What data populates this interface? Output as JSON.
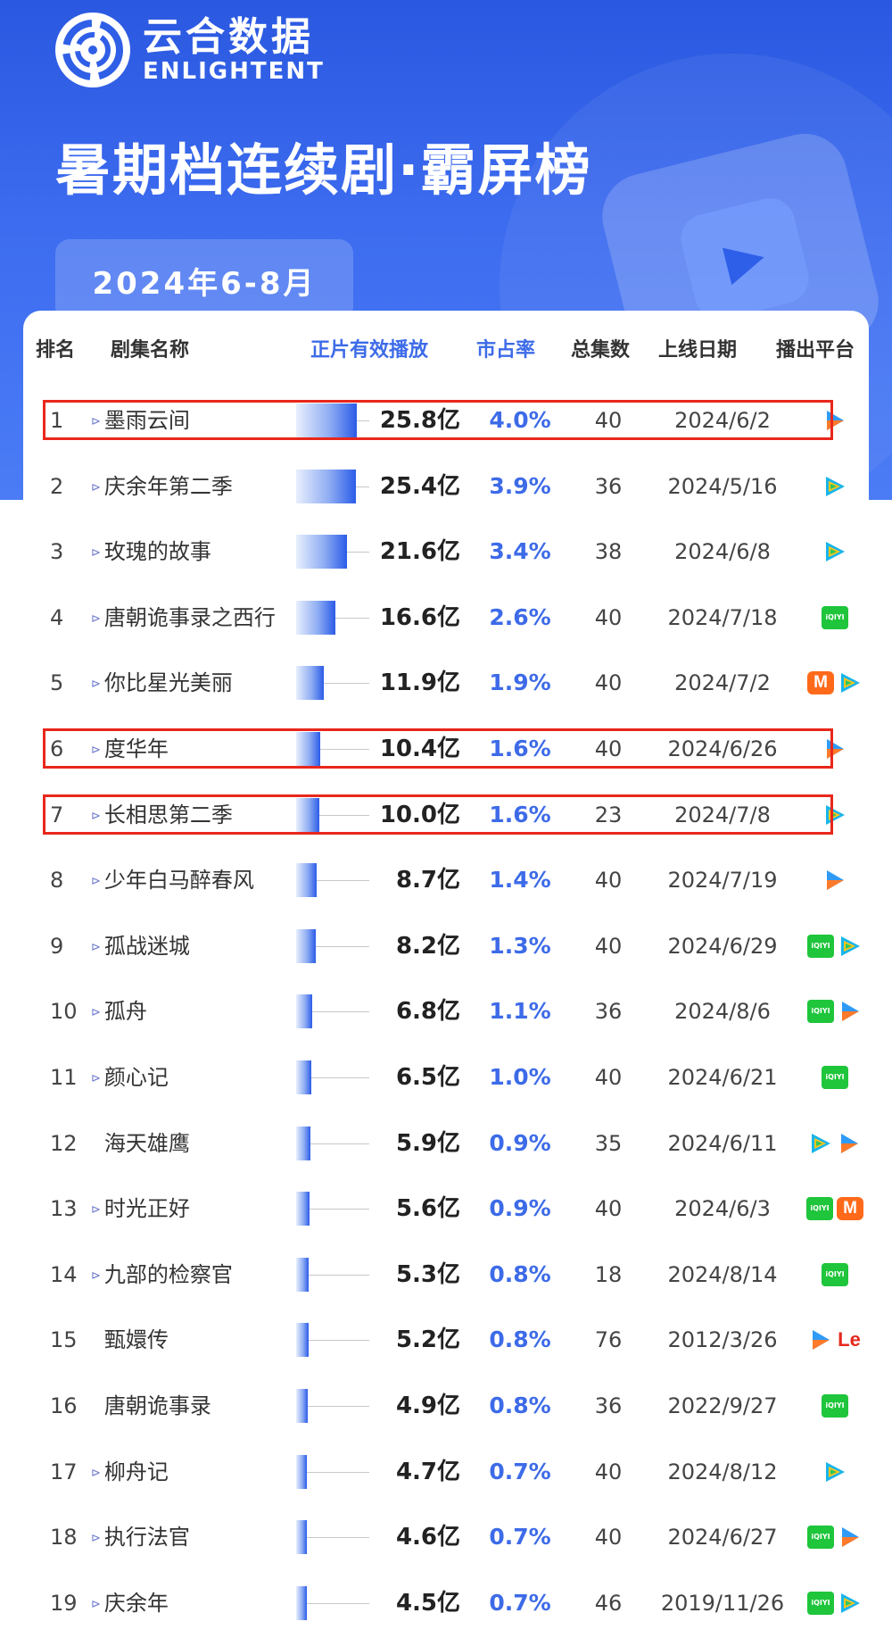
{
  "brand": {
    "name_cn": "云合数据",
    "name_en": "ENLIGHTENT"
  },
  "title": "暑期档连续剧·霸屏榜",
  "period": "2024年6-8月",
  "columns": {
    "rank": "排名",
    "name": "剧集名称",
    "plays": "正片有效播放",
    "share": "市占率",
    "episodes": "总集数",
    "date": "上线日期",
    "platform": "播出平台"
  },
  "colors": {
    "accent_blue": "#3d6be8",
    "highlight_red": "#e8271b",
    "iqiyi_green": "#1fc53b",
    "mango_orange": "#ff6a1a",
    "tencent_play": "#19b5ea",
    "youku_blue": "#2f9bf6"
  },
  "highlighted_ranks": [
    "1",
    "6",
    "7"
  ],
  "rows": [
    {
      "rank": "1",
      "name": "墨雨云间",
      "marker": true,
      "plays_value": 25.8,
      "plays": "25.8亿",
      "share": "4.0%",
      "episodes": "40",
      "date": "2024/6/2",
      "platforms": [
        "youku"
      ]
    },
    {
      "rank": "2",
      "name": "庆余年第二季",
      "marker": true,
      "plays_value": 25.4,
      "plays": "25.4亿",
      "share": "3.9%",
      "episodes": "36",
      "date": "2024/5/16",
      "platforms": [
        "tencent"
      ]
    },
    {
      "rank": "3",
      "name": "玫瑰的故事",
      "marker": true,
      "plays_value": 21.6,
      "plays": "21.6亿",
      "share": "3.4%",
      "episodes": "38",
      "date": "2024/6/8",
      "platforms": [
        "tencent"
      ]
    },
    {
      "rank": "4",
      "name": "唐朝诡事录之西行",
      "marker": true,
      "plays_value": 16.6,
      "plays": "16.6亿",
      "share": "2.6%",
      "episodes": "40",
      "date": "2024/7/18",
      "platforms": [
        "iqiyi"
      ]
    },
    {
      "rank": "5",
      "name": "你比星光美丽",
      "marker": true,
      "plays_value": 11.9,
      "plays": "11.9亿",
      "share": "1.9%",
      "episodes": "40",
      "date": "2024/7/2",
      "platforms": [
        "mango",
        "tencent"
      ]
    },
    {
      "rank": "6",
      "name": "度华年",
      "marker": true,
      "plays_value": 10.4,
      "plays": "10.4亿",
      "share": "1.6%",
      "episodes": "40",
      "date": "2024/6/26",
      "platforms": [
        "youku"
      ]
    },
    {
      "rank": "7",
      "name": "长相思第二季",
      "marker": true,
      "plays_value": 10.0,
      "plays": "10.0亿",
      "share": "1.6%",
      "episodes": "23",
      "date": "2024/7/8",
      "platforms": [
        "tencent"
      ]
    },
    {
      "rank": "8",
      "name": "少年白马醉春风",
      "marker": true,
      "plays_value": 8.7,
      "plays": "8.7亿",
      "share": "1.4%",
      "episodes": "40",
      "date": "2024/7/19",
      "platforms": [
        "youku"
      ]
    },
    {
      "rank": "9",
      "name": "孤战迷城",
      "marker": true,
      "plays_value": 8.2,
      "plays": "8.2亿",
      "share": "1.3%",
      "episodes": "40",
      "date": "2024/6/29",
      "platforms": [
        "iqiyi",
        "tencent"
      ]
    },
    {
      "rank": "10",
      "name": "孤舟",
      "marker": true,
      "plays_value": 6.8,
      "plays": "6.8亿",
      "share": "1.1%",
      "episodes": "36",
      "date": "2024/8/6",
      "platforms": [
        "iqiyi",
        "youku"
      ]
    },
    {
      "rank": "11",
      "name": "颜心记",
      "marker": true,
      "plays_value": 6.5,
      "plays": "6.5亿",
      "share": "1.0%",
      "episodes": "40",
      "date": "2024/6/21",
      "platforms": [
        "iqiyi"
      ]
    },
    {
      "rank": "12",
      "name": "海天雄鹰",
      "marker": false,
      "plays_value": 5.9,
      "plays": "5.9亿",
      "share": "0.9%",
      "episodes": "35",
      "date": "2024/6/11",
      "platforms": [
        "tencent",
        "youku"
      ]
    },
    {
      "rank": "13",
      "name": "时光正好",
      "marker": true,
      "plays_value": 5.6,
      "plays": "5.6亿",
      "share": "0.9%",
      "episodes": "40",
      "date": "2024/6/3",
      "platforms": [
        "iqiyi",
        "mango"
      ]
    },
    {
      "rank": "14",
      "name": "九部的检察官",
      "marker": true,
      "plays_value": 5.3,
      "plays": "5.3亿",
      "share": "0.8%",
      "episodes": "18",
      "date": "2024/8/14",
      "platforms": [
        "iqiyi"
      ]
    },
    {
      "rank": "15",
      "name": "甄嬛传",
      "marker": false,
      "plays_value": 5.2,
      "plays": "5.2亿",
      "share": "0.8%",
      "episodes": "76",
      "date": "2012/3/26",
      "platforms": [
        "youku",
        "le"
      ]
    },
    {
      "rank": "16",
      "name": "唐朝诡事录",
      "marker": false,
      "plays_value": 4.9,
      "plays": "4.9亿",
      "share": "0.8%",
      "episodes": "36",
      "date": "2022/9/27",
      "platforms": [
        "iqiyi"
      ]
    },
    {
      "rank": "17",
      "name": "柳舟记",
      "marker": true,
      "plays_value": 4.7,
      "plays": "4.7亿",
      "share": "0.7%",
      "episodes": "40",
      "date": "2024/8/12",
      "platforms": [
        "tencent"
      ]
    },
    {
      "rank": "18",
      "name": "执行法官",
      "marker": true,
      "plays_value": 4.6,
      "plays": "4.6亿",
      "share": "0.7%",
      "episodes": "40",
      "date": "2024/6/27",
      "platforms": [
        "iqiyi",
        "youku"
      ]
    },
    {
      "rank": "19",
      "name": "庆余年",
      "marker": true,
      "plays_value": 4.5,
      "plays": "4.5亿",
      "share": "0.7%",
      "episodes": "46",
      "date": "2019/11/26",
      "platforms": [
        "iqiyi",
        "tencent"
      ]
    }
  ]
}
